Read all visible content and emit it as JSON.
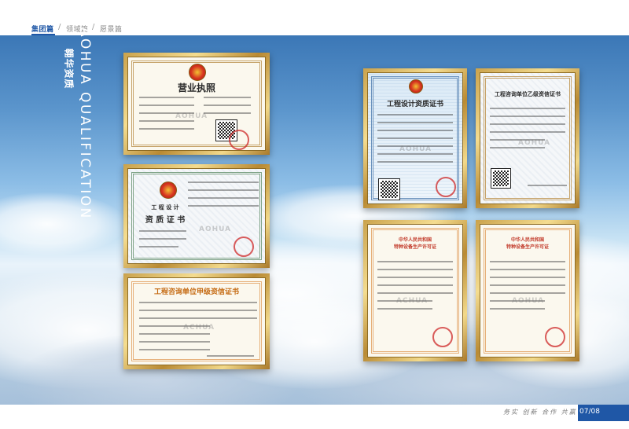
{
  "nav": {
    "tabs": [
      {
        "label": "集团篇",
        "active": true
      },
      {
        "label": "领域篇",
        "active": false
      },
      {
        "label": "愿景篇",
        "active": false
      }
    ],
    "separator": "/"
  },
  "section": {
    "title_en": "AOHUA QUALIFICATION",
    "title_cn": "翱华资质"
  },
  "certificates": {
    "business_license": {
      "title": "营业执照",
      "watermark": "AOHUA"
    },
    "qualification_cert": {
      "title_line1": "工  程  设  计",
      "title_line2": "资  质  证  书",
      "watermark": "AOHUA"
    },
    "grade_a_credit": {
      "title": "工程咨询单位甲级资信证书",
      "watermark": "ACHUA"
    },
    "design_qualification": {
      "title": "工程设计资质证书",
      "watermark": "AOHUA"
    },
    "grade_b_credit": {
      "title": "工程咨询单位乙级资信证书",
      "watermark": "AOHUA"
    },
    "special_equipment_1": {
      "title_line1": "中华人民共和国",
      "title_line2": "特种设备生产许可证",
      "watermark": "ACHUA"
    },
    "special_equipment_2": {
      "title_line1": "中华人民共和国",
      "title_line2": "特种设备生产许可证",
      "watermark": "AOHUA"
    }
  },
  "footer": {
    "slogan": "务实  创新  合作  共赢",
    "page_number": "07/08",
    "accent_color": "#1f57a6"
  }
}
